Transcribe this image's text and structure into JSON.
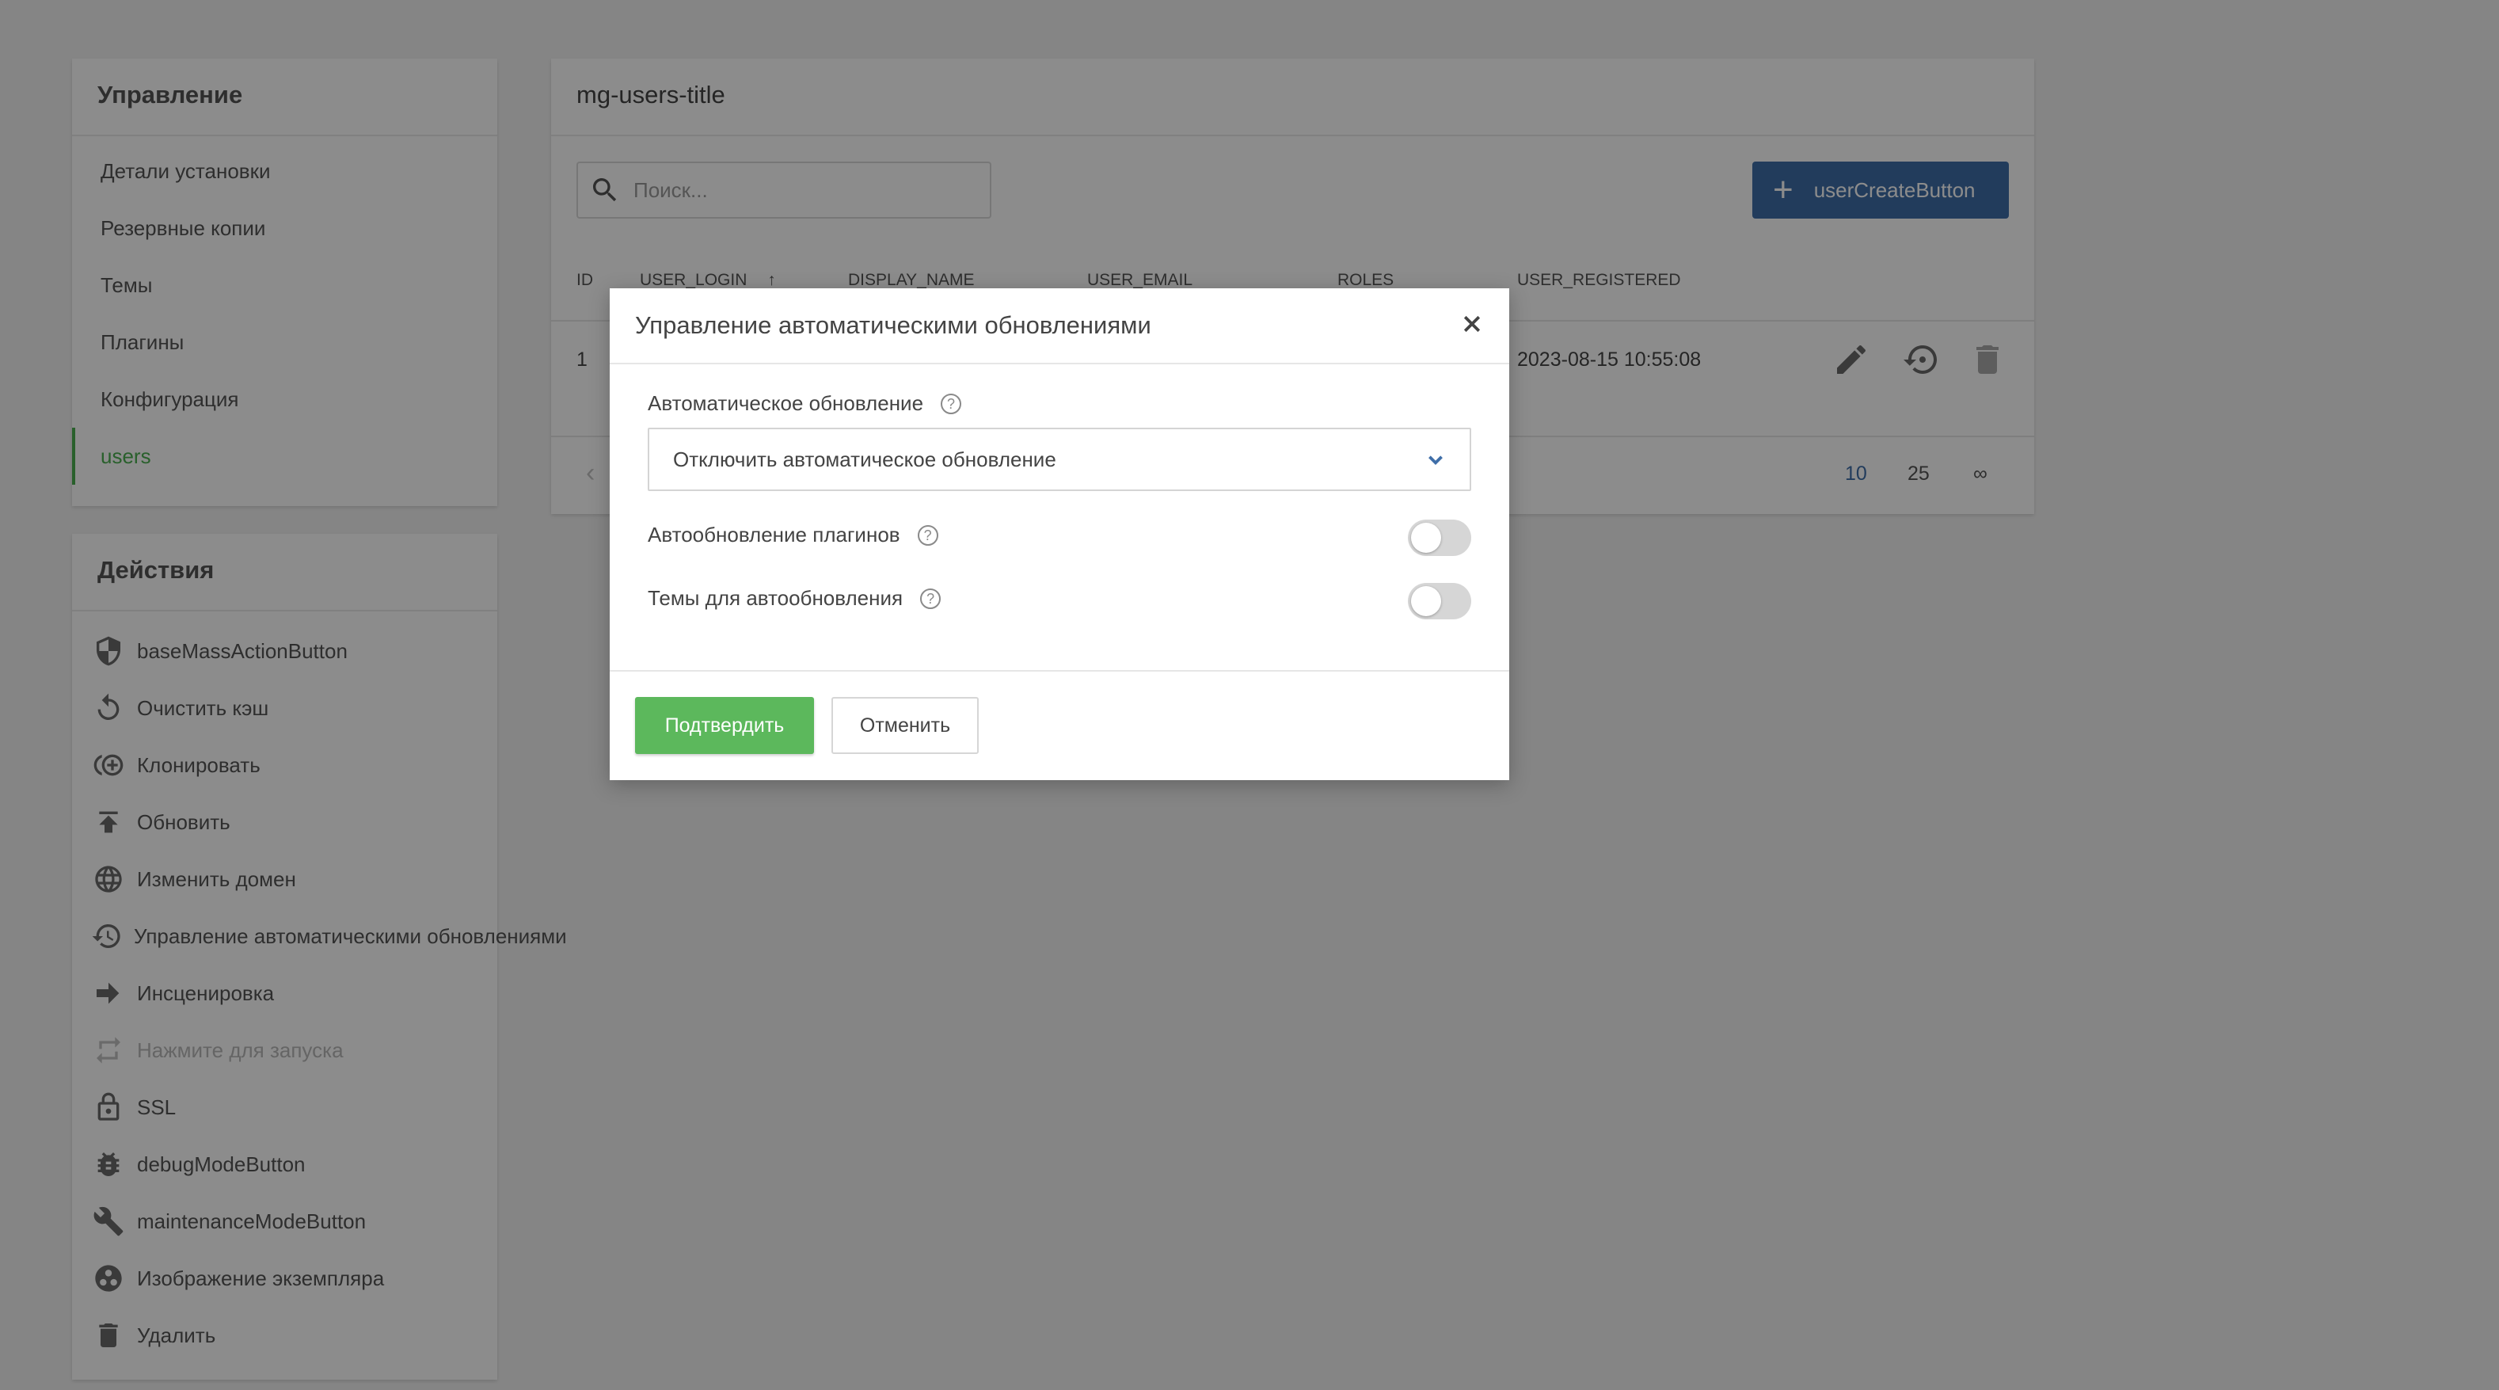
{
  "management": {
    "title": "Управление",
    "items": [
      {
        "label": "Детали установки"
      },
      {
        "label": "Резервные копии"
      },
      {
        "label": "Темы"
      },
      {
        "label": "Плагины"
      },
      {
        "label": "Конфигурация"
      },
      {
        "label": "users"
      }
    ],
    "active_item": "users"
  },
  "actions": {
    "title": "Действия",
    "items": [
      {
        "label": "baseMassActionButton",
        "icon": "shield-icon"
      },
      {
        "label": "Очистить кэш",
        "icon": "refresh-icon"
      },
      {
        "label": "Клонировать",
        "icon": "clone-icon"
      },
      {
        "label": "Обновить",
        "icon": "upload-icon"
      },
      {
        "label": "Изменить домен",
        "icon": "globe-icon"
      },
      {
        "label": "Управление автоматическими обновлениями",
        "icon": "history-icon"
      },
      {
        "label": "Инсценировка",
        "icon": "arrow-right-icon"
      },
      {
        "label": "Нажмите для запуска",
        "icon": "repeat-icon",
        "disabled": true
      },
      {
        "label": "SSL",
        "icon": "lock-icon"
      },
      {
        "label": "debugModeButton",
        "icon": "bug-icon"
      },
      {
        "label": "maintenanceModeButton",
        "icon": "wrench-icon"
      },
      {
        "label": "Изображение экземпляра",
        "icon": "image-icon"
      },
      {
        "label": "Удалить",
        "icon": "trash-icon"
      }
    ]
  },
  "users": {
    "title": "mg-users-title",
    "search_placeholder": "Поиск...",
    "create_button": "userCreateButton",
    "columns": [
      "ID",
      "USER_LOGIN",
      "DISPLAY_NAME",
      "USER_EMAIL",
      "ROLES",
      "USER_REGISTERED"
    ],
    "rows": [
      {
        "id": "1",
        "user_registered": "2023-08-15 10:55:08"
      }
    ],
    "page_sizes": [
      "10",
      "25",
      "∞"
    ],
    "active_page_size": "10"
  },
  "modal": {
    "title": "Управление автоматическими обновлениями",
    "auto_update_label": "Автоматическое обновление",
    "auto_update_value": "Отключить автоматическое обновление",
    "plugins_label": "Автообновление плагинов",
    "plugins_enabled": false,
    "themes_label": "Темы для автообновления",
    "themes_enabled": false,
    "confirm_label": "Подтвердить",
    "cancel_label": "Отменить"
  },
  "colors": {
    "accent_green": "#5cb85c",
    "primary_blue": "#3f6ea8"
  }
}
